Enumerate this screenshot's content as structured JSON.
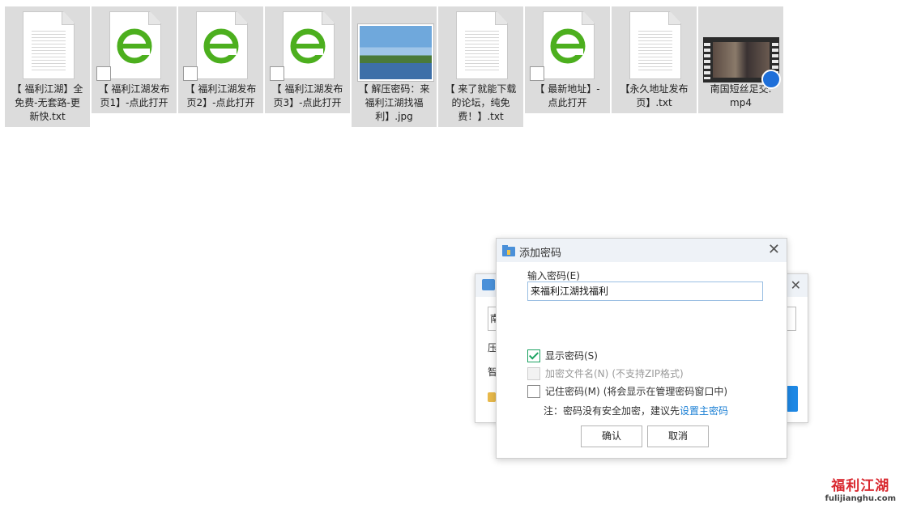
{
  "files": [
    {
      "type": "txt",
      "name": "【 福利江湖】全\n免费-无套路-更\n新快.txt"
    },
    {
      "type": "ie",
      "name": "【 福利江湖发布\n页1】-点此打开"
    },
    {
      "type": "ie",
      "name": "【 福利江湖发布\n页2】-点此打开"
    },
    {
      "type": "ie",
      "name": "【 福利江湖发布\n页3】-点此打开"
    },
    {
      "type": "jpg",
      "name": "【 解压密码：来\n福利江湖找福\n利】.jpg"
    },
    {
      "type": "txt",
      "name": "【 来了就能下载\n的论坛，纯免\n费！】.txt"
    },
    {
      "type": "ie",
      "name": "【 最新地址】-\n点此打开"
    },
    {
      "type": "txt",
      "name": "【永久地址发布\n页】.txt"
    },
    {
      "type": "mp4",
      "name": "南国短丝足交.\nmp4"
    }
  ],
  "background_dialog": {
    "field_left_char": "南",
    "label_1": "压",
    "label_2": "智"
  },
  "dialog": {
    "title": "添加密码",
    "close_glyph": "✕",
    "password_label": "输入密码(E)",
    "password_value": "来福利江湖找福利",
    "options": {
      "show_password": {
        "label": "显示密码(S)",
        "checked": true,
        "disabled": false
      },
      "encrypt_filenames": {
        "label": "加密文件名(N)",
        "note": "(不支持ZIP格式)",
        "checked": false,
        "disabled": true
      },
      "remember_password": {
        "label": "记住密码(M)",
        "note": "(将会显示在管理密码窗口中)",
        "checked": false,
        "disabled": false
      }
    },
    "note_text": "注：密码没有安全加密，建议先",
    "note_link": "设置主密码",
    "ok_label": "确认",
    "cancel_label": "取消"
  },
  "watermark": {
    "title": "福利江湖",
    "url": "fulijianghu.com"
  },
  "colors": {
    "accent_blue": "#1a7fd4",
    "check_green": "#1ba261",
    "ie_green": "#4caf1e",
    "watermark_red": "#d9282f"
  }
}
